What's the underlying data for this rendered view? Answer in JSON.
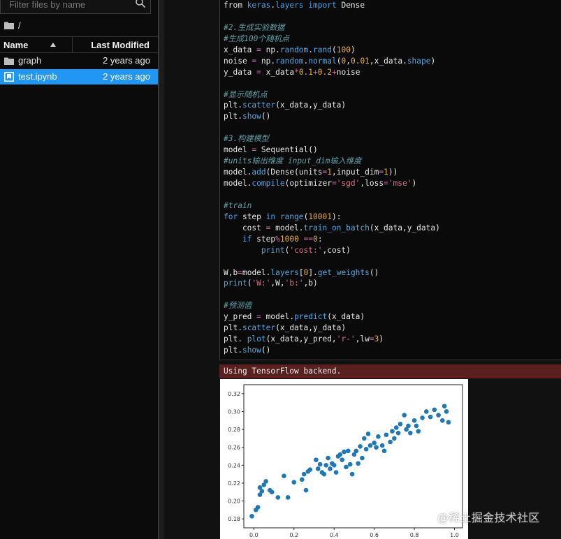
{
  "file_browser": {
    "search_placeholder": "Filter files by name",
    "path": "/",
    "columns": {
      "name": "Name",
      "modified": "Last Modified"
    },
    "files": [
      {
        "name": "graph",
        "modified": "2 years ago",
        "icon": "folder-icon",
        "selected": false
      },
      {
        "name": "test.ipynb",
        "modified": "2 years ago",
        "icon": "notebook-icon",
        "selected": true
      }
    ]
  },
  "code_lines": [
    [
      [
        "t",
        "from "
      ],
      [
        "kw",
        "keras"
      ],
      [
        "t",
        "."
      ],
      [
        "kw",
        "layers"
      ],
      [
        "t",
        " "
      ],
      [
        "kw",
        "import"
      ],
      [
        "t",
        " Dense"
      ]
    ],
    [],
    [
      [
        "cm",
        "#2.生成实验数据"
      ]
    ],
    [
      [
        "cm",
        "#生成100个随机点"
      ]
    ],
    [
      [
        "t",
        "x_data "
      ],
      [
        "op",
        "="
      ],
      [
        "t",
        " np."
      ],
      [
        "fn",
        "random"
      ],
      [
        "t",
        "."
      ],
      [
        "fn",
        "rand"
      ],
      [
        "t",
        "("
      ],
      [
        "num",
        "100"
      ],
      [
        "t",
        ")"
      ]
    ],
    [
      [
        "t",
        "noise "
      ],
      [
        "op",
        "="
      ],
      [
        "t",
        " np."
      ],
      [
        "fn",
        "random"
      ],
      [
        "t",
        "."
      ],
      [
        "fn",
        "normal"
      ],
      [
        "t",
        "("
      ],
      [
        "num",
        "0"
      ],
      [
        "t",
        ","
      ],
      [
        "num",
        "0.01"
      ],
      [
        "t",
        ",x_data."
      ],
      [
        "fn",
        "shape"
      ],
      [
        "t",
        ")"
      ]
    ],
    [
      [
        "t",
        "y_data "
      ],
      [
        "op",
        "="
      ],
      [
        "t",
        " x_data"
      ],
      [
        "op",
        "*"
      ],
      [
        "num",
        "0.1"
      ],
      [
        "op",
        "+"
      ],
      [
        "num",
        "0.2"
      ],
      [
        "op",
        "+"
      ],
      [
        "t",
        "noise"
      ]
    ],
    [],
    [
      [
        "cm",
        "#显示随机点"
      ]
    ],
    [
      [
        "t",
        "plt."
      ],
      [
        "fn",
        "scatter"
      ],
      [
        "t",
        "(x_data,y_data)"
      ]
    ],
    [
      [
        "t",
        "plt."
      ],
      [
        "fn",
        "show"
      ],
      [
        "t",
        "()"
      ]
    ],
    [],
    [
      [
        "cm",
        "#3.构建模型"
      ]
    ],
    [
      [
        "t",
        "model "
      ],
      [
        "op",
        "="
      ],
      [
        "t",
        " Sequential()"
      ]
    ],
    [
      [
        "cm",
        "#units输出维度 input_dim输入维度"
      ]
    ],
    [
      [
        "t",
        "model."
      ],
      [
        "fn",
        "add"
      ],
      [
        "t",
        "(Dense(units"
      ],
      [
        "op",
        "="
      ],
      [
        "num",
        "1"
      ],
      [
        "t",
        ",input_dim"
      ],
      [
        "op",
        "="
      ],
      [
        "num",
        "1"
      ],
      [
        "t",
        "))"
      ]
    ],
    [
      [
        "t",
        "model."
      ],
      [
        "fn",
        "compile"
      ],
      [
        "t",
        "(optimizer"
      ],
      [
        "op",
        "="
      ],
      [
        "str",
        "'sgd'"
      ],
      [
        "t",
        ",loss"
      ],
      [
        "op",
        "="
      ],
      [
        "str",
        "'mse'"
      ],
      [
        "t",
        ")"
      ]
    ],
    [],
    [
      [
        "cm",
        "#train"
      ]
    ],
    [
      [
        "kw",
        "for"
      ],
      [
        "t",
        " step "
      ],
      [
        "kw",
        "in"
      ],
      [
        "t",
        " "
      ],
      [
        "fn",
        "range"
      ],
      [
        "t",
        "("
      ],
      [
        "num",
        "10001"
      ],
      [
        "t",
        "):"
      ]
    ],
    [
      [
        "t",
        "    cost "
      ],
      [
        "op",
        "="
      ],
      [
        "t",
        " model."
      ],
      [
        "fn",
        "train_on_batch"
      ],
      [
        "t",
        "(x_data,y_data)"
      ]
    ],
    [
      [
        "t",
        "    "
      ],
      [
        "kw",
        "if"
      ],
      [
        "t",
        " step"
      ],
      [
        "op",
        "%"
      ],
      [
        "num",
        "1000"
      ],
      [
        "t",
        " "
      ],
      [
        "op",
        "=="
      ],
      [
        "num",
        "0"
      ],
      [
        "t",
        ":"
      ]
    ],
    [
      [
        "t",
        "        "
      ],
      [
        "fn",
        "print"
      ],
      [
        "t",
        "("
      ],
      [
        "str",
        "'cost:'"
      ],
      [
        "t",
        ",cost)"
      ]
    ],
    [],
    [
      [
        "t",
        "W,b"
      ],
      [
        "op",
        "="
      ],
      [
        "t",
        "model."
      ],
      [
        "fn",
        "layers"
      ],
      [
        "t",
        "["
      ],
      [
        "num",
        "0"
      ],
      [
        "t",
        "]."
      ],
      [
        "fn",
        "get_weights"
      ],
      [
        "t",
        "()"
      ]
    ],
    [
      [
        "fn",
        "print"
      ],
      [
        "t",
        "("
      ],
      [
        "str",
        "'W:'"
      ],
      [
        "t",
        ",W,"
      ],
      [
        "str",
        "'b:'"
      ],
      [
        "t",
        ",b)"
      ]
    ],
    [],
    [
      [
        "cm",
        "#预测值"
      ]
    ],
    [
      [
        "t",
        "y_pred "
      ],
      [
        "op",
        "="
      ],
      [
        "t",
        " model."
      ],
      [
        "fn",
        "predict"
      ],
      [
        "t",
        "(x_data)"
      ]
    ],
    [
      [
        "t",
        "plt."
      ],
      [
        "fn",
        "scatter"
      ],
      [
        "t",
        "(x_data,y_data)"
      ]
    ],
    [
      [
        "t",
        "plt. "
      ],
      [
        "fn",
        "plot"
      ],
      [
        "t",
        "(x_data,y_pred,"
      ],
      [
        "str",
        "'r-'"
      ],
      [
        "t",
        ",lw"
      ],
      [
        "op",
        "="
      ],
      [
        "num",
        "3"
      ],
      [
        "t",
        ")"
      ]
    ],
    [
      [
        "t",
        "plt."
      ],
      [
        "fn",
        "show"
      ],
      [
        "t",
        "()"
      ]
    ]
  ],
  "output": {
    "stderr": "Using TensorFlow backend."
  },
  "chart_data": {
    "type": "scatter",
    "title": "",
    "xlabel": "",
    "ylabel": "",
    "xlim": [
      -0.05,
      1.04
    ],
    "ylim": [
      0.17,
      0.33
    ],
    "xticks": [
      "0.0",
      "0.2",
      "0.4",
      "0.6",
      "0.8",
      "1.0"
    ],
    "yticks": [
      "0.18",
      "0.20",
      "0.22",
      "0.24",
      "0.26",
      "0.28",
      "0.30",
      "0.32"
    ],
    "grid": false,
    "color": "#1f77b4",
    "x": [
      -0.01,
      0.01,
      0.02,
      0.03,
      0.03,
      0.04,
      0.05,
      0.06,
      0.08,
      0.09,
      0.12,
      0.15,
      0.17,
      0.2,
      0.24,
      0.25,
      0.26,
      0.27,
      0.28,
      0.31,
      0.32,
      0.33,
      0.34,
      0.35,
      0.36,
      0.37,
      0.38,
      0.39,
      0.4,
      0.41,
      0.42,
      0.43,
      0.44,
      0.45,
      0.46,
      0.47,
      0.48,
      0.49,
      0.5,
      0.51,
      0.52,
      0.53,
      0.54,
      0.55,
      0.56,
      0.57,
      0.58,
      0.6,
      0.61,
      0.62,
      0.64,
      0.65,
      0.66,
      0.68,
      0.69,
      0.7,
      0.71,
      0.72,
      0.73,
      0.75,
      0.76,
      0.77,
      0.78,
      0.8,
      0.81,
      0.82,
      0.84,
      0.86,
      0.88,
      0.9,
      0.92,
      0.94,
      0.95,
      0.96,
      0.97
    ],
    "y": [
      0.183,
      0.19,
      0.193,
      0.207,
      0.215,
      0.211,
      0.218,
      0.222,
      0.212,
      0.21,
      0.204,
      0.228,
      0.204,
      0.221,
      0.224,
      0.23,
      0.212,
      0.233,
      0.235,
      0.246,
      0.236,
      0.241,
      0.232,
      0.23,
      0.24,
      0.248,
      0.236,
      0.242,
      0.24,
      0.232,
      0.25,
      0.252,
      0.246,
      0.255,
      0.238,
      0.256,
      0.241,
      0.23,
      0.252,
      0.256,
      0.242,
      0.261,
      0.248,
      0.27,
      0.258,
      0.275,
      0.262,
      0.265,
      0.26,
      0.272,
      0.262,
      0.256,
      0.274,
      0.266,
      0.278,
      0.27,
      0.282,
      0.276,
      0.286,
      0.296,
      0.28,
      0.284,
      0.276,
      0.29,
      0.284,
      0.278,
      0.293,
      0.3,
      0.294,
      0.302,
      0.296,
      0.29,
      0.306,
      0.3,
      0.288
    ]
  },
  "watermark": "@稀土掘金技术社区"
}
